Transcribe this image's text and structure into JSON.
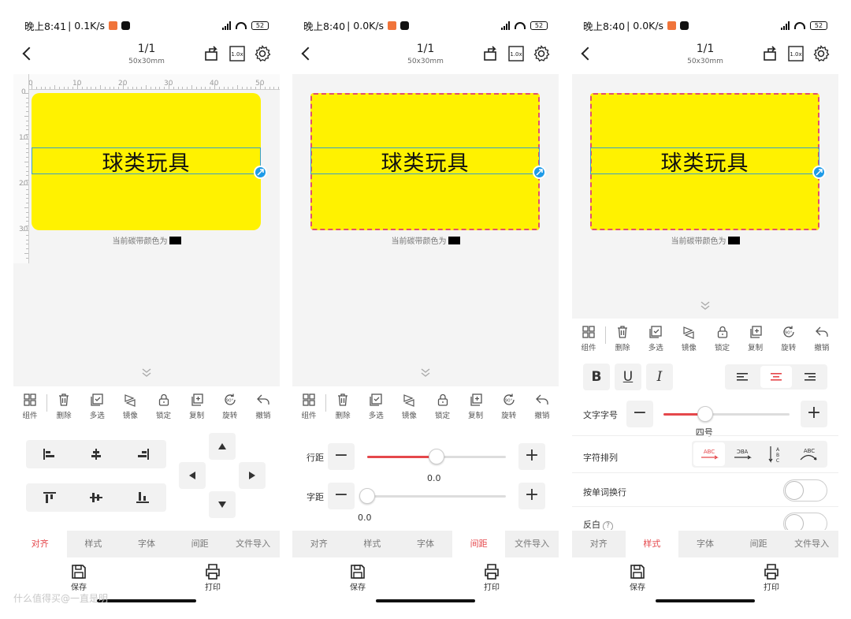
{
  "colors": {
    "accent": "#e5474b",
    "label": "#fff200",
    "selection": "#3aa0c8",
    "dash": "#e24f6e",
    "handle": "#1e9be8"
  },
  "phones": [
    {
      "status": {
        "time": "晚上8:41",
        "speed": "| 0.1K/s",
        "battery": "52"
      },
      "nav": {
        "title": "1/1",
        "subtitle": "50x30mm"
      },
      "ruler": {
        "top": [
          "0",
          "10",
          "20",
          "30",
          "40",
          "50"
        ],
        "left": [
          "0",
          "10",
          "20",
          "30"
        ]
      },
      "label_text": "球类玩具",
      "ribbon": "当前碳带颜色为"
    },
    {
      "status": {
        "time": "晚上8:40",
        "speed": "| 0.0K/s",
        "battery": "52"
      },
      "nav": {
        "title": "1/1",
        "subtitle": "50x30mm"
      },
      "label_text": "球类玩具",
      "ribbon": "当前碳带颜色为"
    },
    {
      "status": {
        "time": "晚上8:40",
        "speed": "| 0.0K/s",
        "battery": "52"
      },
      "nav": {
        "title": "1/1",
        "subtitle": "50x30mm"
      },
      "label_text": "球类玩具",
      "ribbon": "当前碳带颜色为"
    }
  ],
  "toolbar": [
    {
      "label": "组件",
      "icon": "grid-icon"
    },
    {
      "label": "删除",
      "icon": "trash-icon"
    },
    {
      "label": "多选",
      "icon": "multi-select-icon"
    },
    {
      "label": "镜像",
      "icon": "mirror-icon"
    },
    {
      "label": "锁定",
      "icon": "lock-icon"
    },
    {
      "label": "复制",
      "icon": "copy-icon"
    },
    {
      "label": "旋转",
      "icon": "rotate-icon"
    },
    {
      "label": "撤销",
      "icon": "undo-icon"
    }
  ],
  "tabs": [
    "对齐",
    "样式",
    "字体",
    "间距",
    "文件导入"
  ],
  "active_tabs": [
    0,
    3,
    1
  ],
  "spacing": {
    "line_label": "行距",
    "line_value": "0.0",
    "line_level": 0.5,
    "char_label": "字距",
    "char_value": "0.0",
    "char_level": 0.0
  },
  "style": {
    "bold": "B",
    "underline": "U",
    "italic": "I",
    "size_label": "文字字号",
    "size_value": "四号",
    "size_level": 0.33,
    "arrange_label": "字符排列",
    "wrap_label": "按单词换行",
    "wrap_on": false,
    "invert_label": "反白",
    "invert_help": "?",
    "invert_on": false,
    "arrange_options": [
      "ABC",
      "ABC",
      "ABC",
      "ABC"
    ]
  },
  "bottom": {
    "save": "保存",
    "print": "打印"
  },
  "watermark": "什么值得买@一直是明"
}
